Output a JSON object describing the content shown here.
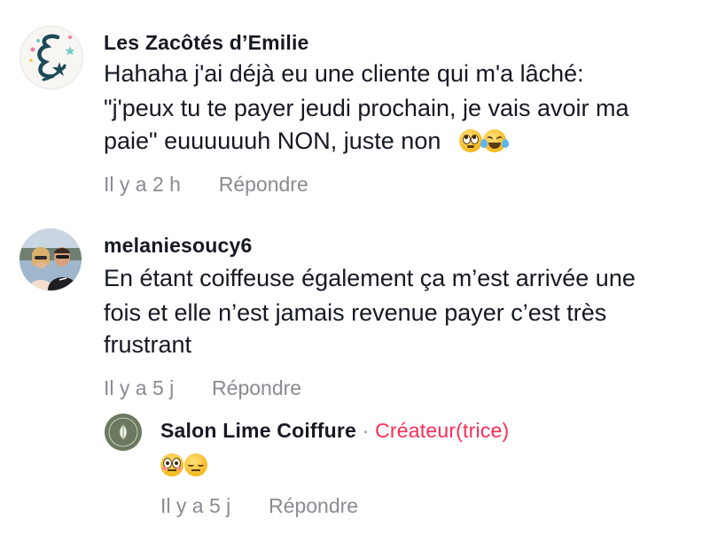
{
  "comments": [
    {
      "author": "Les Zacôtés d’Emilie",
      "lines": [
        "Hahaha j'ai déjà eu une cliente qui m'a lâché:",
        "\"j'peux tu te payer jeudi prochain, je vais avoir ma",
        "paie\" euuuuuuh NON, juste non"
      ],
      "emojis": [
        "face-with-rolling-eyes",
        "face-with-tears-of-joy"
      ],
      "time": "Il y a 2 h",
      "reply_label": "Répondre"
    },
    {
      "author": "melaniesoucy6",
      "lines": [
        "En étant coiffeuse également ça m’est arrivée une",
        "fois et elle n’est jamais revenue payer c’est très",
        "frustrant"
      ],
      "time": "Il y a 5 j",
      "reply_label": "Répondre"
    }
  ],
  "reply": {
    "author": "Salon Lime Coiffure",
    "separator": "·",
    "creator_badge": "Créateur(trice)",
    "emojis": [
      "flushed-face",
      "pensive-face"
    ],
    "time": "Il y a 5 j",
    "reply_label": "Répondre"
  },
  "colors": {
    "text": "#161823",
    "muted": "#8a8b91",
    "creator": "#fe2c55"
  }
}
